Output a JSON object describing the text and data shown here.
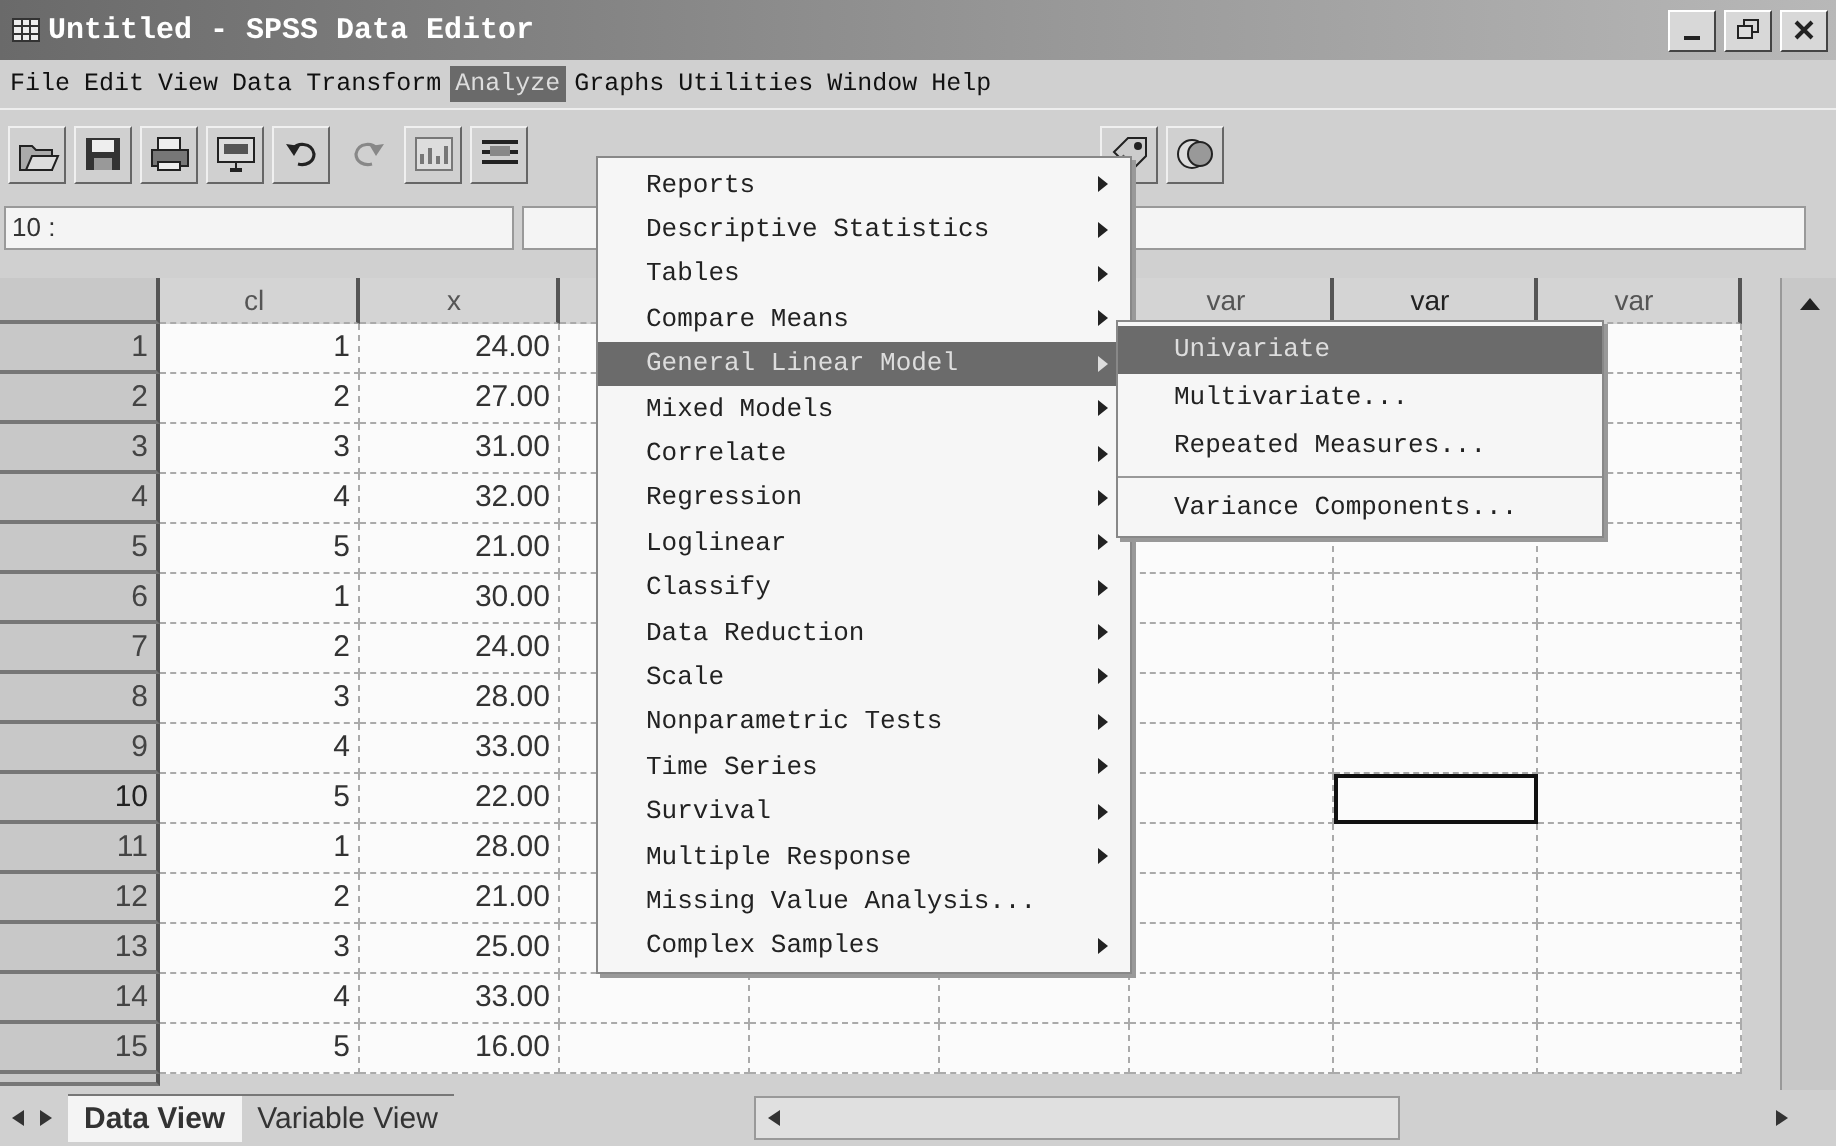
{
  "window": {
    "title": "Untitled - SPSS Data Editor"
  },
  "menu_bar": [
    {
      "label": "File",
      "selected": false
    },
    {
      "label": "Edit",
      "selected": false
    },
    {
      "label": "View",
      "selected": false
    },
    {
      "label": "Data",
      "selected": false
    },
    {
      "label": "Transform",
      "selected": false
    },
    {
      "label": "Analyze",
      "selected": true
    },
    {
      "label": "Graphs",
      "selected": false
    },
    {
      "label": "Utilities",
      "selected": false
    },
    {
      "label": "Window",
      "selected": false
    },
    {
      "label": "Help",
      "selected": false
    }
  ],
  "toolbar": {
    "left": [
      {
        "kind": "open",
        "disabled": false
      },
      {
        "kind": "save",
        "disabled": false
      },
      {
        "kind": "print",
        "disabled": false
      },
      {
        "kind": "recall",
        "disabled": false
      },
      {
        "kind": "undo",
        "disabled": false
      },
      {
        "kind": "redo",
        "disabled": true
      },
      {
        "kind": "chart",
        "disabled": false
      },
      {
        "kind": "insert",
        "disabled": false
      }
    ],
    "right": [
      {
        "kind": "labels",
        "disabled": false
      },
      {
        "kind": "sets",
        "disabled": false
      }
    ]
  },
  "cell_reference": "10 :",
  "grid": {
    "columns": [
      {
        "kind": "variable",
        "label": "cl",
        "selected": false
      },
      {
        "kind": "variable",
        "label": "x",
        "selected": false
      },
      {
        "kind": "covered"
      },
      {
        "kind": "covered"
      },
      {
        "kind": "covered"
      },
      {
        "kind": "empty",
        "label": "var",
        "selected": false
      },
      {
        "kind": "empty",
        "label": "var",
        "selected": true
      },
      {
        "kind": "empty",
        "label": "var",
        "selected": false
      }
    ],
    "rows": [
      {
        "number": "1",
        "cells": [
          "1",
          "24.00"
        ],
        "selected": false
      },
      {
        "number": "2",
        "cells": [
          "2",
          "27.00"
        ],
        "selected": false
      },
      {
        "number": "3",
        "cells": [
          "3",
          "31.00"
        ],
        "selected": false
      },
      {
        "number": "4",
        "cells": [
          "4",
          "32.00"
        ],
        "selected": false
      },
      {
        "number": "5",
        "cells": [
          "5",
          "21.00"
        ],
        "selected": false
      },
      {
        "number": "6",
        "cells": [
          "1",
          "30.00"
        ],
        "selected": false
      },
      {
        "number": "7",
        "cells": [
          "2",
          "24.00"
        ],
        "selected": false
      },
      {
        "number": "8",
        "cells": [
          "3",
          "28.00"
        ],
        "selected": false
      },
      {
        "number": "9",
        "cells": [
          "4",
          "33.00"
        ],
        "selected": false
      },
      {
        "number": "10",
        "cells": [
          "5",
          "22.00"
        ],
        "selected": true
      },
      {
        "number": "11",
        "cells": [
          "1",
          "28.00"
        ],
        "selected": false
      },
      {
        "number": "12",
        "cells": [
          "2",
          "21.00"
        ],
        "selected": false
      },
      {
        "number": "13",
        "cells": [
          "3",
          "25.00"
        ],
        "selected": false
      },
      {
        "number": "14",
        "cells": [
          "4",
          "33.00"
        ],
        "selected": false
      },
      {
        "number": "15",
        "cells": [
          "5",
          "16.00"
        ],
        "selected": false
      }
    ]
  },
  "analyze_menu": [
    {
      "label": "Reports",
      "submenu": true,
      "selected": false
    },
    {
      "label": "Descriptive Statistics",
      "submenu": true,
      "selected": false
    },
    {
      "label": "Tables",
      "submenu": true,
      "selected": false
    },
    {
      "label": "Compare Means",
      "submenu": true,
      "selected": false
    },
    {
      "label": "General Linear Model",
      "submenu": true,
      "selected": true
    },
    {
      "label": "Mixed Models",
      "submenu": true,
      "selected": false
    },
    {
      "label": "Correlate",
      "submenu": true,
      "selected": false
    },
    {
      "label": "Regression",
      "submenu": true,
      "selected": false
    },
    {
      "label": "Loglinear",
      "submenu": true,
      "selected": false
    },
    {
      "label": "Classify",
      "submenu": true,
      "selected": false
    },
    {
      "label": "Data Reduction",
      "submenu": true,
      "selected": false
    },
    {
      "label": "Scale",
      "submenu": true,
      "selected": false
    },
    {
      "label": "Nonparametric Tests",
      "submenu": true,
      "selected": false
    },
    {
      "label": "Time Series",
      "submenu": true,
      "selected": false
    },
    {
      "label": "Survival",
      "submenu": true,
      "selected": false
    },
    {
      "label": "Multiple Response",
      "submenu": true,
      "selected": false
    },
    {
      "label": "Missing Value Analysis...",
      "submenu": false,
      "selected": false
    },
    {
      "label": "Complex Samples",
      "submenu": true,
      "selected": false
    }
  ],
  "glm_submenu": [
    {
      "label": "Univariate",
      "selected": true,
      "divider_above": false
    },
    {
      "label": "Multivariate...",
      "selected": false,
      "divider_above": false
    },
    {
      "label": "Repeated Measures...",
      "selected": false,
      "divider_above": false
    },
    {
      "label": "Variance Components...",
      "selected": false,
      "divider_above": true
    }
  ],
  "sheet_tabs": [
    {
      "label": "Data View",
      "selected": true
    },
    {
      "label": "Variable View",
      "selected": false
    }
  ]
}
